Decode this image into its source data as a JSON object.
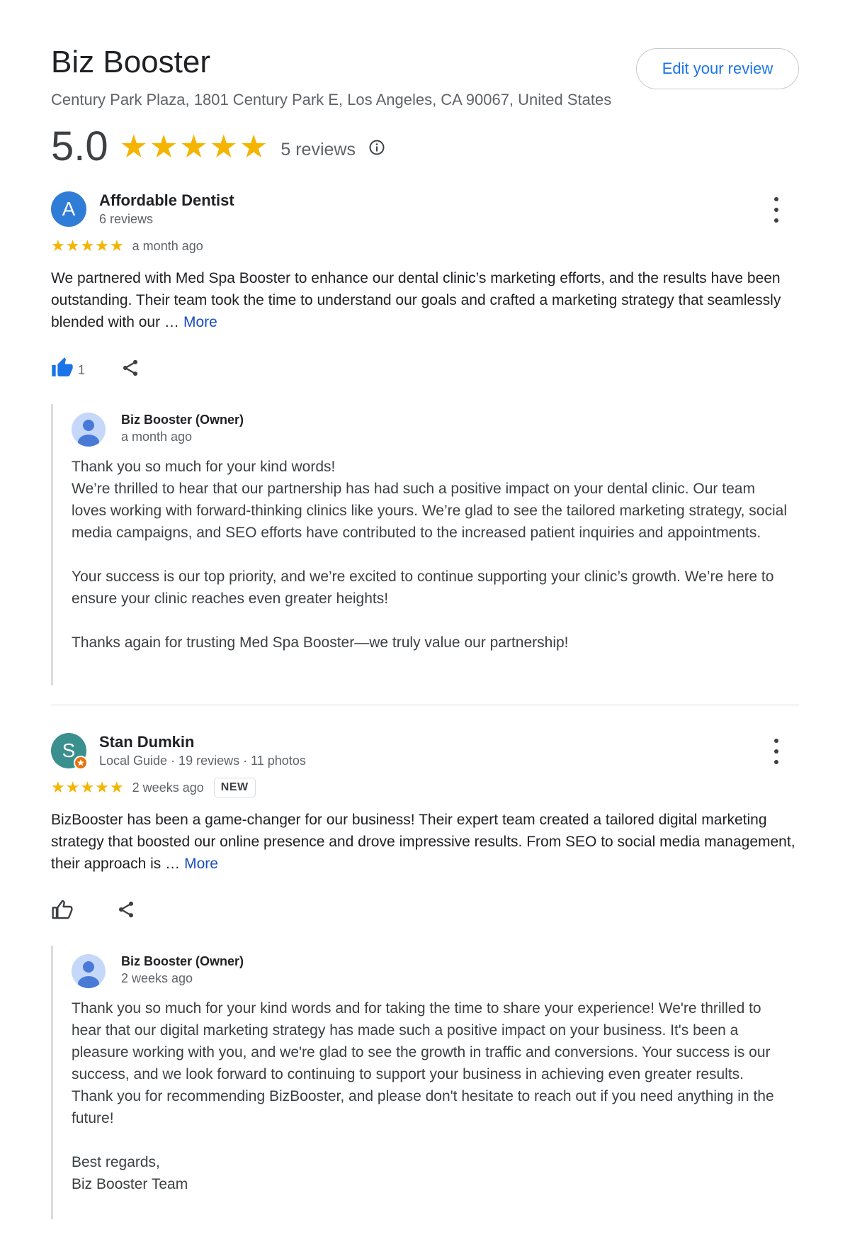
{
  "business": {
    "name": "Biz Booster",
    "address": "Century Park Plaza, 1801 Century Park E, Los Angeles, CA 90067, United States",
    "edit_button": "Edit your review",
    "rating": "5.0",
    "stars": 5,
    "review_count": "5 reviews",
    "info_icon": "info-icon"
  },
  "colors": {
    "star": "#f4b400",
    "link": "#1a73e8",
    "avatar_a": "#4285f4",
    "avatar_s": "#3a8f8f"
  },
  "reviews": [
    {
      "avatar_letter": "A",
      "name": "Affordable Dentist",
      "meta": "6 reviews",
      "stars": 5,
      "time": "a month ago",
      "badge": "",
      "text": "We partnered with Med Spa Booster to enhance our dental clinic’s marketing efforts, and the results have been outstanding. Their team took the time to understand our goals and crafted a marketing strategy that seamlessly blended with our …",
      "more": "More",
      "likes": "1",
      "owner": {
        "name": "Biz Booster (Owner)",
        "time": "a month ago",
        "paragraphs": [
          "Thank you so much for your kind words!",
          "We’re thrilled to hear that our partnership has had such a positive impact on your dental clinic. Our team loves working with forward-thinking clinics like yours. We’re glad to see the tailored marketing strategy, social media campaigns, and SEO efforts have contributed to the increased patient inquiries and appointments.",
          "Your success is our top priority, and we’re excited to continue supporting your clinic’s growth. We’re here to ensure your clinic reaches even greater heights!",
          "Thanks again for trusting Med Spa Booster—we truly value our partnership!"
        ]
      }
    },
    {
      "avatar_letter": "S",
      "name": "Stan Dumkin",
      "meta": "Local Guide · 19 reviews · 11 photos",
      "stars": 5,
      "time": "2 weeks ago",
      "badge": "NEW",
      "text": "BizBooster has been a game-changer for our business! Their expert team created a tailored digital marketing strategy that boosted our online presence and drove impressive results. From SEO to social media management, their approach is …",
      "more": "More",
      "likes": "",
      "owner": {
        "name": "Biz Booster (Owner)",
        "time": "2 weeks ago",
        "paragraphs": [
          "Thank you so much for your kind words and for taking the time to share your experience! We're thrilled to hear that our digital marketing strategy has made such a positive impact on your business. It's been a pleasure working with you, and we're glad to see the growth in traffic and conversions. Your success is our success, and we look forward to continuing to support your business in achieving even greater results. Thank you for recommending BizBooster, and please don't hesitate to reach out if you need anything in the future!",
          "Best regards,",
          "Biz Booster Team"
        ]
      }
    }
  ]
}
